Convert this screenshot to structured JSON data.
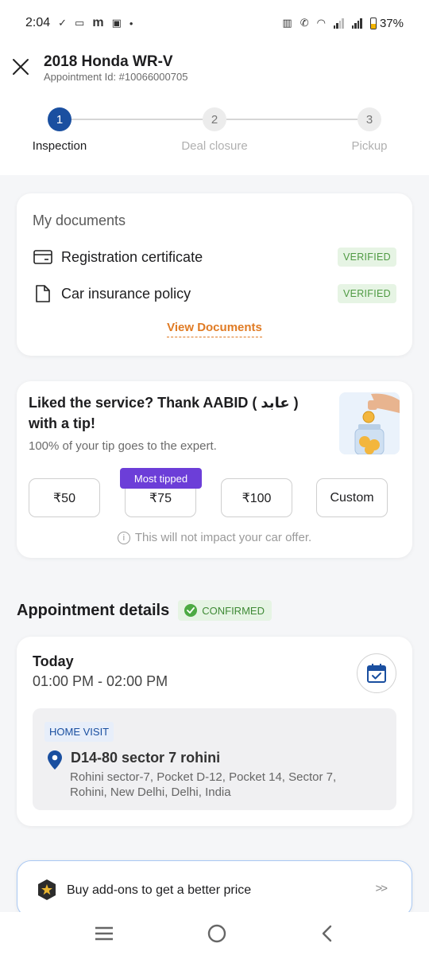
{
  "status_bar": {
    "time": "2:04",
    "battery": "37%"
  },
  "header": {
    "title": "2018 Honda WR-V",
    "appointment_id": "Appointment Id: #10066000705"
  },
  "stepper": {
    "steps": [
      {
        "number": "1",
        "label": "Inspection",
        "active": true
      },
      {
        "number": "2",
        "label": "Deal closure",
        "active": false
      },
      {
        "number": "3",
        "label": "Pickup",
        "active": false
      }
    ]
  },
  "documents": {
    "title": "My documents",
    "items": [
      {
        "label": "Registration certificate",
        "status": "VERIFIED"
      },
      {
        "label": "Car insurance policy",
        "status": "VERIFIED"
      }
    ],
    "view_label": "View Documents"
  },
  "tip": {
    "title": "Liked the service? Thank AABID ( عابد ) with a tip!",
    "subtitle": "100% of your tip goes to the expert.",
    "most_tipped": "Most tipped",
    "options": [
      "₹50",
      "₹75",
      "₹100",
      "Custom"
    ],
    "note": "This will not impact your car offer."
  },
  "appointment": {
    "title": "Appointment details",
    "status": "CONFIRMED",
    "day": "Today",
    "time": "01:00 PM - 02:00 PM",
    "visit_type": "HOME VISIT",
    "address_title": "D14-80 sector 7 rohini",
    "address_detail": "Rohini sector-7, Pocket D-12, Pocket 14, Sector 7, Rohini, New Delhi, Delhi, India"
  },
  "addons": {
    "label": "Buy add-ons to get a better price",
    "arrow": ">>"
  },
  "colors": {
    "primary_blue": "#1a4fa0",
    "verified_green": "#4f9a43",
    "link_orange": "#e07b24",
    "most_tipped_purple": "#6c3ed8"
  }
}
